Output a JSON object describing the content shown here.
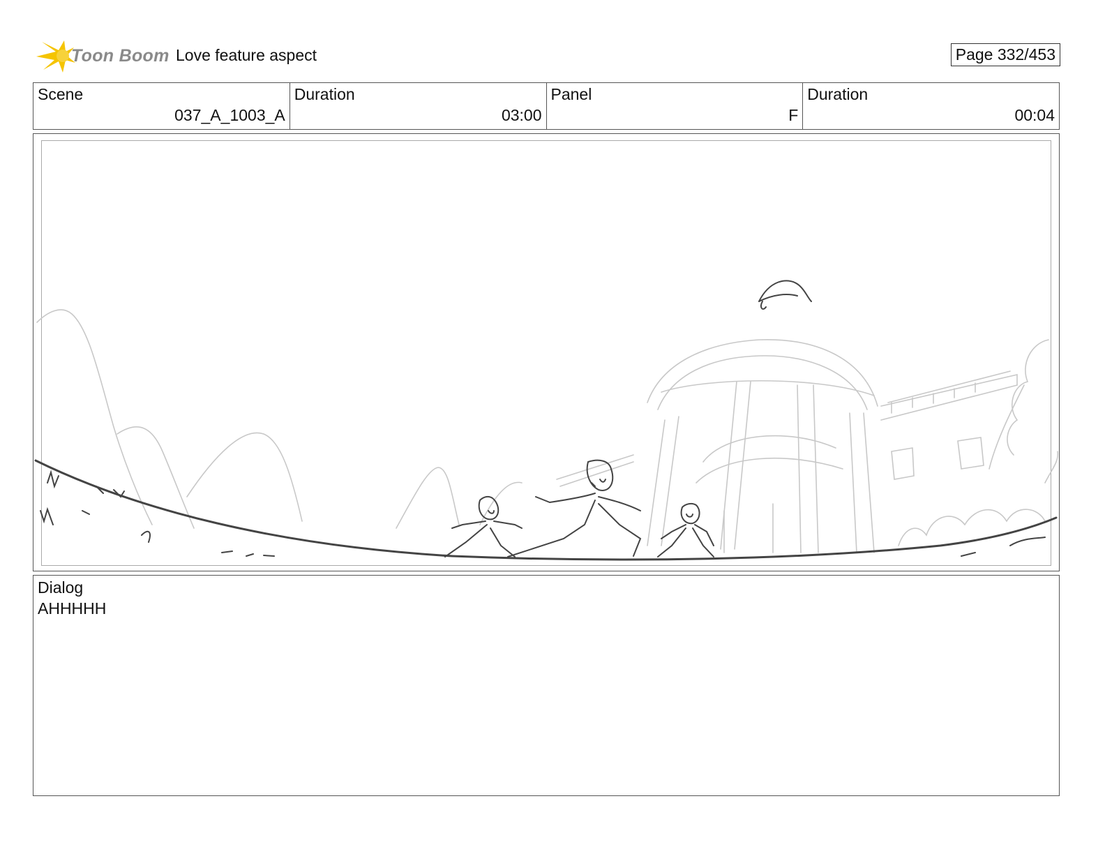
{
  "header": {
    "logo_text": "Toon Boom",
    "title": "Love feature aspect",
    "page": "Page 332/453"
  },
  "info": {
    "scene_label": "Scene",
    "scene_value": "037_A_1003_A",
    "duration_label": "Duration",
    "duration_value": "03:00",
    "panel_label": "Panel",
    "panel_value": "F",
    "panel_duration_label": "Duration",
    "panel_duration_value": "00:04"
  },
  "dialog": {
    "label": "Dialog",
    "text": "AHHHHH"
  },
  "colors": {
    "logo_yellow": "#f5c400",
    "logo_gray": "#8a8a8a",
    "sketch_dark": "#444444",
    "sketch_light": "#c4c4c4"
  }
}
